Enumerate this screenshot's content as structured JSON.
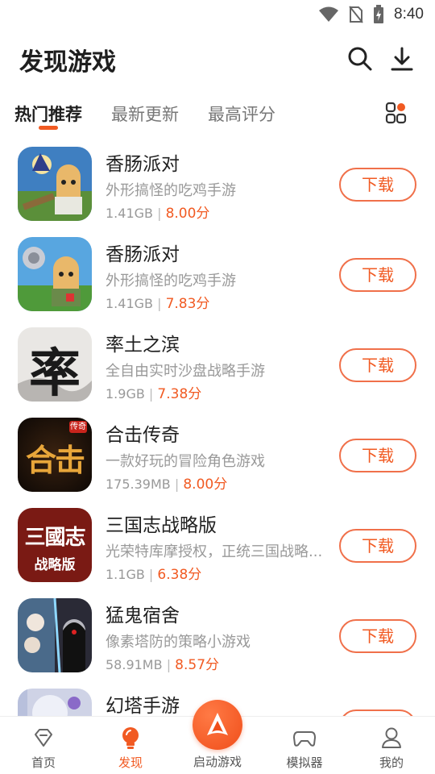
{
  "status_bar": {
    "time": "8:40"
  },
  "header": {
    "title": "发现游戏"
  },
  "tabs": [
    {
      "label": "热门推荐",
      "active": true
    },
    {
      "label": "最新更新",
      "active": false
    },
    {
      "label": "最高评分",
      "active": false
    }
  ],
  "colors": {
    "accent": "#f15a22",
    "muted": "#999999",
    "title": "#1f1f1f"
  },
  "games": [
    {
      "name": "香肠派对",
      "desc": "外形搞怪的吃鸡手游",
      "size": "1.41GB",
      "score": "8.00分",
      "button": "下载"
    },
    {
      "name": "香肠派对",
      "desc": "外形搞怪的吃鸡手游",
      "size": "1.41GB",
      "score": "7.83分",
      "button": "下载"
    },
    {
      "name": "率土之滨",
      "desc": "全自由实时沙盘战略手游",
      "size": "1.9GB",
      "score": "7.38分",
      "button": "下载"
    },
    {
      "name": "合击传奇",
      "desc": "一款好玩的冒险角色游戏",
      "size": "175.39MB",
      "score": "8.00分",
      "button": "下载"
    },
    {
      "name": "三国志战略版",
      "desc": "光荣特库摩授权，正统三国战略...",
      "size": "1.1GB",
      "score": "6.38分",
      "button": "下载"
    },
    {
      "name": "猛鬼宿舍",
      "desc": "像素塔防的策略小游戏",
      "size": "58.91MB",
      "score": "8.57分",
      "button": "下载"
    },
    {
      "name": "幻塔手游",
      "desc": "",
      "size": "",
      "score": "",
      "button": ""
    }
  ],
  "icon_text": {
    "game3": "率",
    "game4_main": "合击",
    "game4_badge": "传奇",
    "game5_top": "三國志",
    "game5_bottom": "战略版"
  },
  "bottom_nav": {
    "home": "首页",
    "discover": "发现",
    "launch": "启动游戏",
    "emulator": "模拟器",
    "mine": "我的"
  }
}
